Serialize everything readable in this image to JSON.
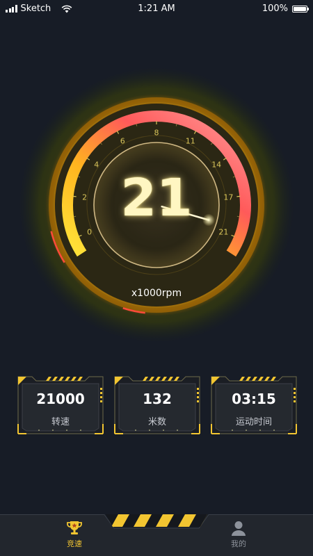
{
  "status_bar": {
    "carrier": "Sketch",
    "time": "1:21 AM",
    "battery": "100%"
  },
  "gauge": {
    "value": "21",
    "unit": "x1000rpm",
    "tick_labels": [
      "0",
      "2",
      "4",
      "6",
      "8",
      "11",
      "14",
      "17",
      "21"
    ],
    "current_reading": 21,
    "max_reading": 21
  },
  "stats": [
    {
      "value": "21000",
      "label": "转速"
    },
    {
      "value": "132",
      "label": "米数"
    },
    {
      "value": "03:15",
      "label": "运动时间"
    }
  ],
  "tabbar": {
    "items": [
      {
        "label": "竞速",
        "icon": "trophy-icon",
        "active": true
      },
      {
        "label": "我的",
        "icon": "user-icon",
        "active": false
      }
    ]
  },
  "colors": {
    "background": "#171c26",
    "accent_yellow": "#f2c531",
    "gauge_red": "#ff5a5a",
    "text_inactive": "#8d929b"
  }
}
